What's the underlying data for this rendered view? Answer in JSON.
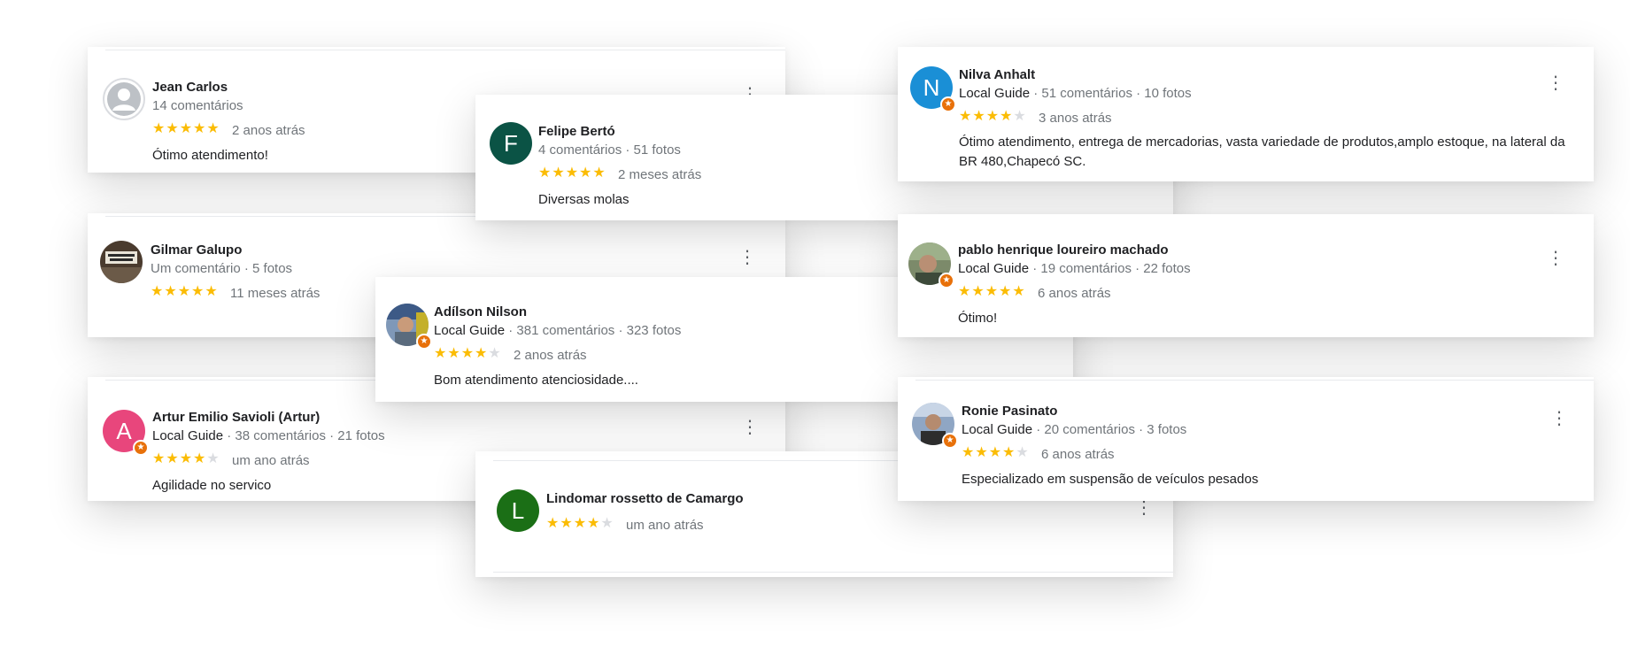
{
  "reviews": {
    "jean": {
      "initial": "",
      "name": "Jean Carlos",
      "meta": "14 comentários",
      "rating": 5,
      "time": "2 anos atrás",
      "text": "Ótimo atendimento!"
    },
    "gilmar": {
      "initial": "",
      "name": "Gilmar Galupo",
      "meta": "Um comentário · 5 fotos",
      "rating": 5,
      "time": "11 meses atrás",
      "text": ""
    },
    "artur": {
      "initial": "A",
      "name": "Artur Emilio Savioli (Artur)",
      "local_guide": "Local Guide",
      "meta": " · 38 comentários · 21 fotos",
      "rating": 4,
      "time": "um ano atrás",
      "text": "Agilidade no servico"
    },
    "felipe": {
      "initial": "F",
      "name": "Felipe Bertó",
      "meta": "4 comentários · 51 fotos",
      "rating": 5,
      "time": "2 meses atrás",
      "text": "Diversas molas"
    },
    "adilson": {
      "initial": "",
      "name": "Adílson Nilson",
      "local_guide": "Local Guide",
      "meta": " · 381 comentários · 323 fotos",
      "rating": 4,
      "time": "2 anos atrás",
      "text": "Bom atendimento atenciosidade...."
    },
    "lindomar": {
      "initial": "L",
      "name": "Lindomar rossetto de Camargo",
      "meta": "",
      "rating": 4,
      "time": "um ano atrás",
      "text": ""
    },
    "nilva": {
      "initial": "N",
      "name": "Nilva Anhalt",
      "local_guide": "Local Guide",
      "meta": " · 51 comentários · 10 fotos",
      "rating": 4,
      "time": "3 anos atrás",
      "text": "Ótimo atendimento, entrega de mercadorias, vasta variedade de produtos,amplo estoque, na lateral da BR 480,Chapecó SC."
    },
    "pablo": {
      "initial": "",
      "name": "pablo henrique loureiro machado",
      "local_guide": "Local Guide",
      "meta": " · 19 comentários · 22 fotos",
      "rating": 5,
      "time": "6 anos atrás",
      "text": "Ótimo!"
    },
    "ronie": {
      "initial": "",
      "name": "Ronie Pasinato",
      "local_guide": "Local Guide",
      "meta": " · 20 comentários · 3 fotos",
      "rating": 4,
      "time": "6 anos atrás",
      "text": "Especializado em suspensão de veículos pesados"
    }
  },
  "icons": {
    "more": "more-vert-icon",
    "star": "star-icon",
    "badge": "local-guide-badge-icon",
    "default_avatar": "person-icon"
  },
  "colors": {
    "star": "#fbbc04",
    "star_empty": "#dadce0",
    "avatar_artur": "#e8467c",
    "avatar_felipe": "#0b5345",
    "avatar_lindomar": "#1b6f16",
    "avatar_nilva": "#1a8fd6",
    "badge": "#e8710a"
  }
}
